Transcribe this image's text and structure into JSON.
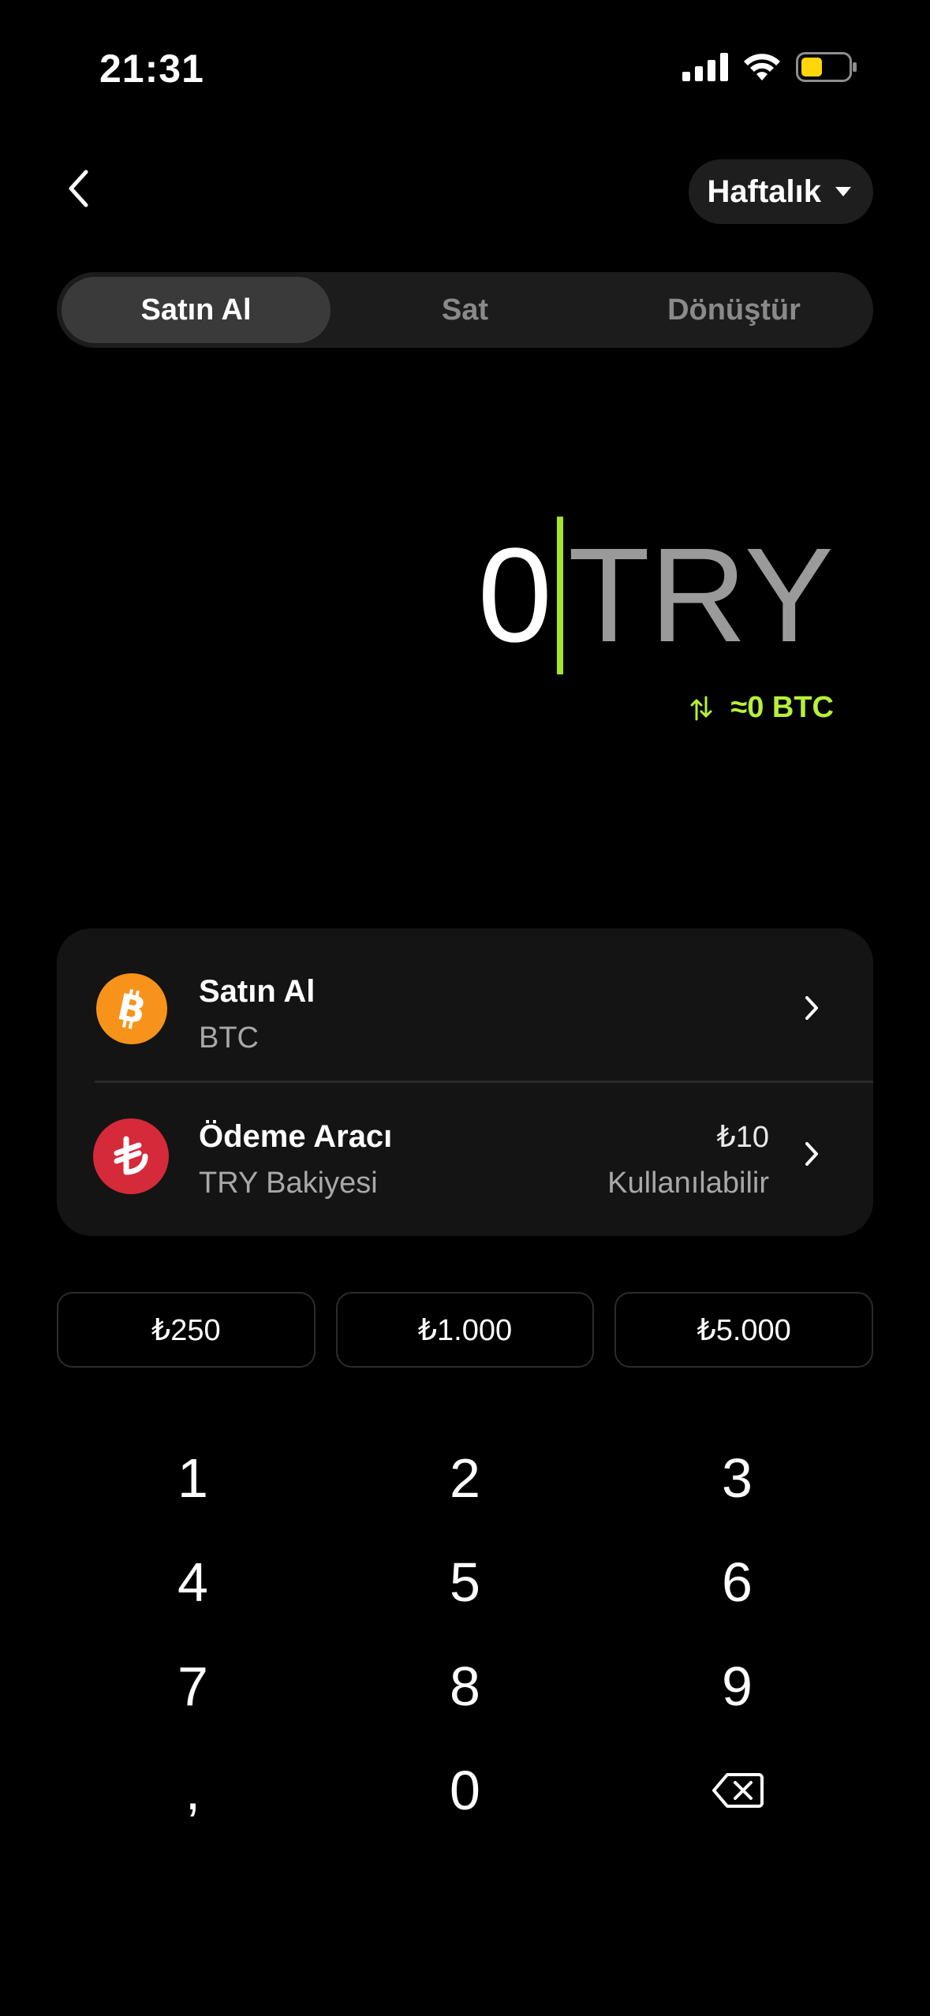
{
  "status": {
    "time": "21:31"
  },
  "header": {
    "period_label": "Haftalık"
  },
  "tabs": [
    {
      "label": "Satın Al",
      "active": true
    },
    {
      "label": "Sat",
      "active": false
    },
    {
      "label": "Dönüştür",
      "active": false
    }
  ],
  "amount": {
    "value": "0",
    "currency": "TRY",
    "conversion": "≈0 BTC"
  },
  "asset_row": {
    "title": "Satın Al",
    "subtitle": "BTC",
    "icon": "bitcoin-icon",
    "color": "#f7931a"
  },
  "payment_row": {
    "title": "Ödeme Aracı",
    "subtitle": "TRY Bakiyesi",
    "balance": "₺10",
    "balance_label": "Kullanılabilir",
    "icon": "lira-icon",
    "color": "#d42a3a"
  },
  "presets": [
    "₺250",
    "₺1.000",
    "₺5.000"
  ],
  "keypad": {
    "rows": [
      [
        "1",
        "2",
        "3"
      ],
      [
        "4",
        "5",
        "6"
      ],
      [
        "7",
        "8",
        "9"
      ],
      [
        ",",
        "0",
        "backspace"
      ]
    ]
  },
  "colors": {
    "accent": "#b6f03a",
    "battery": "#ffd60a"
  }
}
